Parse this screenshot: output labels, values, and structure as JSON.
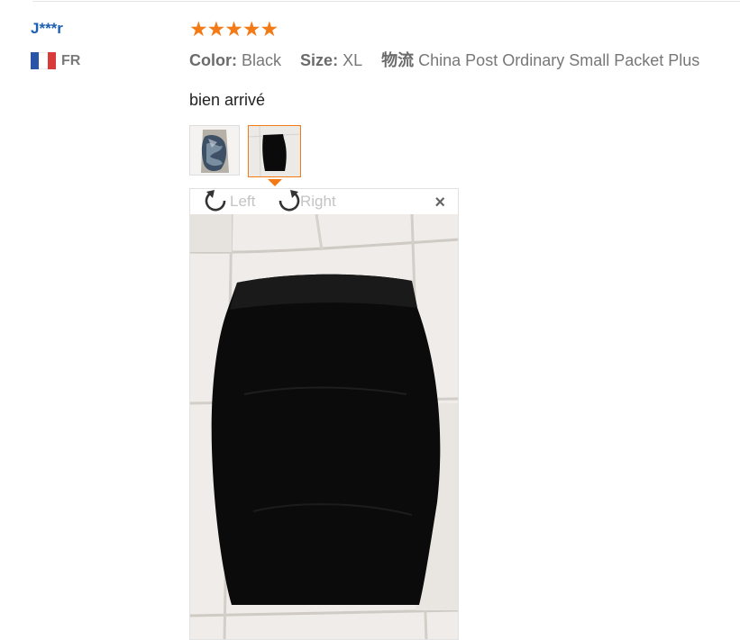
{
  "review": {
    "user_name": "J***r",
    "country_code": "FR",
    "flag_colors": [
      "#2a54a6",
      "#ffffff",
      "#d93a3a"
    ],
    "rating": 5,
    "stars": [
      "★",
      "★",
      "★",
      "★",
      "★"
    ],
    "attributes": [
      {
        "key": "Color:",
        "value": "Black"
      },
      {
        "key": "Size:",
        "value": "XL"
      },
      {
        "key": "物流",
        "value": "China Post Ordinary Small Packet Plus"
      }
    ],
    "text": "bien arrivé"
  },
  "viewer": {
    "rotate_left_label": "Left",
    "rotate_right_label": "Right",
    "close_glyph": "×"
  },
  "colors": {
    "accent": "#f47a16",
    "link": "#1a5fb4",
    "skirt": "#0b0b0b",
    "floor": "#efecea"
  }
}
